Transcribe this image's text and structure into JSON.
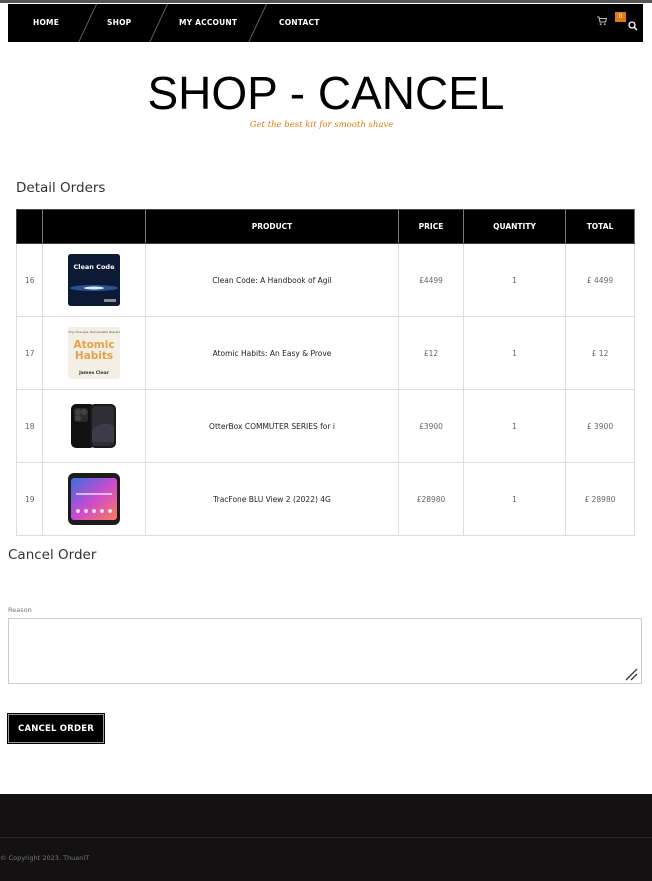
{
  "nav": {
    "items": [
      {
        "label": "HOME"
      },
      {
        "label": "SHOP"
      },
      {
        "label": "MY ACCOUNT"
      },
      {
        "label": "CONTACT"
      }
    ],
    "cart_count": "0",
    "icons": [
      "cart-icon",
      "search-icon"
    ]
  },
  "header": {
    "title": "SHOP - CANCEL",
    "subtitle": "Get the best kit for smooth shave"
  },
  "orders": {
    "heading": "Detail Orders",
    "columns": [
      "",
      "",
      "PRODUCT",
      "PRICE",
      "QUANTITY",
      "TOTAL"
    ],
    "rows": [
      {
        "id": "16",
        "product": "Clean Code: A Handbook of Agil",
        "price": "£4499",
        "quantity": "1",
        "total": "£ 4499",
        "thumb": "clean-code-book"
      },
      {
        "id": "17",
        "product": "Atomic Habits: An Easy & Prove",
        "price": "£12",
        "quantity": "1",
        "total": "£ 12",
        "thumb": "atomic-habits-book"
      },
      {
        "id": "18",
        "product": "OtterBox COMMUTER SERIES for i",
        "price": "£3900",
        "quantity": "1",
        "total": "£ 3900",
        "thumb": "iphone-case"
      },
      {
        "id": "19",
        "product": "TracFone BLU View 2 (2022) 4G",
        "price": "£28980",
        "quantity": "1",
        "total": "£ 28980",
        "thumb": "blu-phone"
      }
    ]
  },
  "cancel": {
    "heading": "Cancel Order",
    "reason_label": "Reason",
    "reason_value": "",
    "button_label": "CANCEL ORDER"
  },
  "thumb_text": {
    "clean_code": "Clean Code",
    "atomic_top": "Tiny Changes, Remarkable Results",
    "atomic_1": "Atomic",
    "atomic_2": "Habits",
    "atomic_author": "James Clear"
  },
  "footer": {
    "copyright": "© Copyright 2023. ThuanIT"
  },
  "colors": {
    "accent": "#e07a10",
    "nav_bg": "#000000",
    "footer_bg": "#131112"
  }
}
